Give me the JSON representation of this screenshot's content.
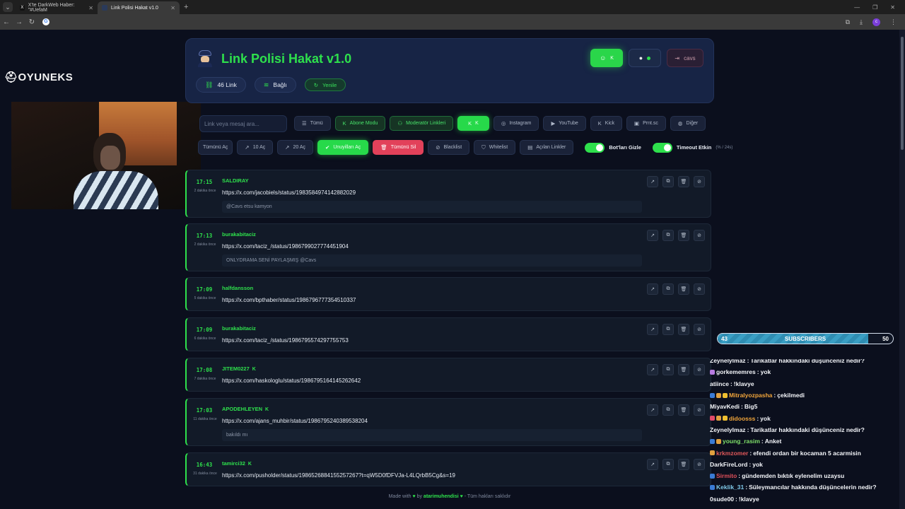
{
  "browser": {
    "tabs": [
      {
        "title": "X'te DarkWeb Haber: \"#UefaM",
        "favicon": "X",
        "active": false
      },
      {
        "title": "Link Polisi Hakat v1.0",
        "favicon": "",
        "active": true
      }
    ]
  },
  "overlay": {
    "logo": "OYUNEKS",
    "subscribers": {
      "current": "43",
      "label": "SUBSCRIBERS",
      "goal": "50",
      "progress": 0.86
    },
    "chat": [
      {
        "user": "Zeynelylmaz",
        "text": "Tarikatlar hakkındaki düşünceniz nedir?",
        "color": "#f4f6fa",
        "badges": []
      },
      {
        "user": "gorkememres",
        "text": "yok",
        "color": "#f4f6fa",
        "badges": [
          "#b77be0"
        ]
      },
      {
        "user": "atiince",
        "text": "!klavye",
        "color": "#f4f6fa",
        "badges": []
      },
      {
        "user": "Mitralyozpasha",
        "text": "çekilmedi",
        "color": "#f0a43a",
        "badges": [
          "#3a7bd5",
          "#e0a040",
          "#f0c030"
        ]
      },
      {
        "user": "MiyavKedi",
        "text": "Big5",
        "color": "#f4f6fa",
        "badges": []
      },
      {
        "user": "didoosss",
        "text": "yok",
        "color": "#f0a43a",
        "badges": [
          "#e04a6a",
          "#e0a040",
          "#f0c030"
        ]
      },
      {
        "user": "Zeynelylmaz",
        "text": "Tarikatlar hakkındaki düşünceniz nedir?",
        "color": "#f4f6fa",
        "badges": []
      },
      {
        "user": "young_rasim",
        "text": "Anket",
        "color": "#7fe06a",
        "badges": [
          "#3a7bd5",
          "#e0a040"
        ]
      },
      {
        "user": "krkmzomer",
        "text": "efendi ordan bir kocaman 5 acarmisin",
        "color": "#e0585a",
        "badges": [
          "#e0a040"
        ]
      },
      {
        "user": "DarkFireLord",
        "text": "yok",
        "color": "#f4f6fa",
        "badges": []
      },
      {
        "user": "Sirmito",
        "text": "gündemden bıktık eylenelim uzaysu",
        "color": "#e0505a",
        "badges": [
          "#3a7bd5"
        ]
      },
      {
        "user": "Keklik_31",
        "text": "Süleymancılar hakkında düşüncelerin nedir?",
        "color": "#7fc8e8",
        "badges": [
          "#3a7bd5"
        ]
      },
      {
        "user": "0sude00",
        "text": "!klavye",
        "color": "#f4f6fa",
        "badges": []
      }
    ]
  },
  "app": {
    "title": "Link Polisi Hakat v1.0",
    "header_buttons": {
      "logout": "cavs"
    },
    "stats": {
      "links": "46 Link",
      "status": "Bağlı",
      "refresh": "Yenile"
    },
    "search_placeholder": "Link veya mesaj ara...",
    "filters": [
      "Tümü",
      "Abone Modu",
      "Moderatör Linkleri",
      "K",
      "Instagram",
      "YouTube",
      "Kick",
      "Prnt.sc",
      "Diğer"
    ],
    "actions": [
      "Tümünü Aç",
      "10 Aç",
      "20 Aç",
      "Unuyilları Aç",
      "Tümünü Sil",
      "Blacklist",
      "Whitelist",
      "Açılan Linkler"
    ],
    "toggles": [
      {
        "label": "Bot'ları Gizle",
        "sub": "",
        "on": true
      },
      {
        "label": "Timeout Etkin",
        "sub": "(% / 24s)",
        "on": true
      }
    ],
    "links": [
      {
        "time": "17:15",
        "ago": "2 dakika önce",
        "user": "SALDIRAY",
        "k": false,
        "url": "https://x.com/jacobiels/status/1983584974142882029",
        "msg": "@Cavs etsu kamyon"
      },
      {
        "time": "17:13",
        "ago": "2 dakika önce",
        "user": "burakabitaciz",
        "k": false,
        "url": "https://x.com/taciz_/status/1986799027774451904",
        "msg": "ONLYDRAMA SENİ PAYLAŞMIŞ @Cavs"
      },
      {
        "time": "17:09",
        "ago": "5 dakika önce",
        "user": "halfdansson",
        "k": false,
        "url": "https://x.com/bpthaber/status/1986796777354510337",
        "msg": ""
      },
      {
        "time": "17:09",
        "ago": "6 dakika önce",
        "user": "burakabitaciz",
        "k": false,
        "url": "https://x.com/taciz_/status/1986795574297755753",
        "msg": ""
      },
      {
        "time": "17:08",
        "ago": "7 dakika önce",
        "user": "JITEM0227",
        "k": true,
        "url": "https://x.com/haskologlu/status/1986795164145262642",
        "msg": ""
      },
      {
        "time": "17:03",
        "ago": "11 dakika önce",
        "user": "APODEHLEYEN",
        "k": true,
        "url": "https://x.com/ajans_muhbir/status/1986795240389538204",
        "msg": "bakıldı mı"
      },
      {
        "time": "16:43",
        "ago": "31 dakika önce",
        "user": "tamirci32",
        "k": true,
        "url": "https://x.com/pusholder/status/1986526884155257267?t=qW5D0fDFVJa-L4LQrbB5Cg&s=19",
        "msg": ""
      }
    ],
    "footer": {
      "pre": "Made with",
      "by": "by",
      "author": "atarimuhendisi",
      "post": "- Tüm hakları saklıdır"
    }
  }
}
